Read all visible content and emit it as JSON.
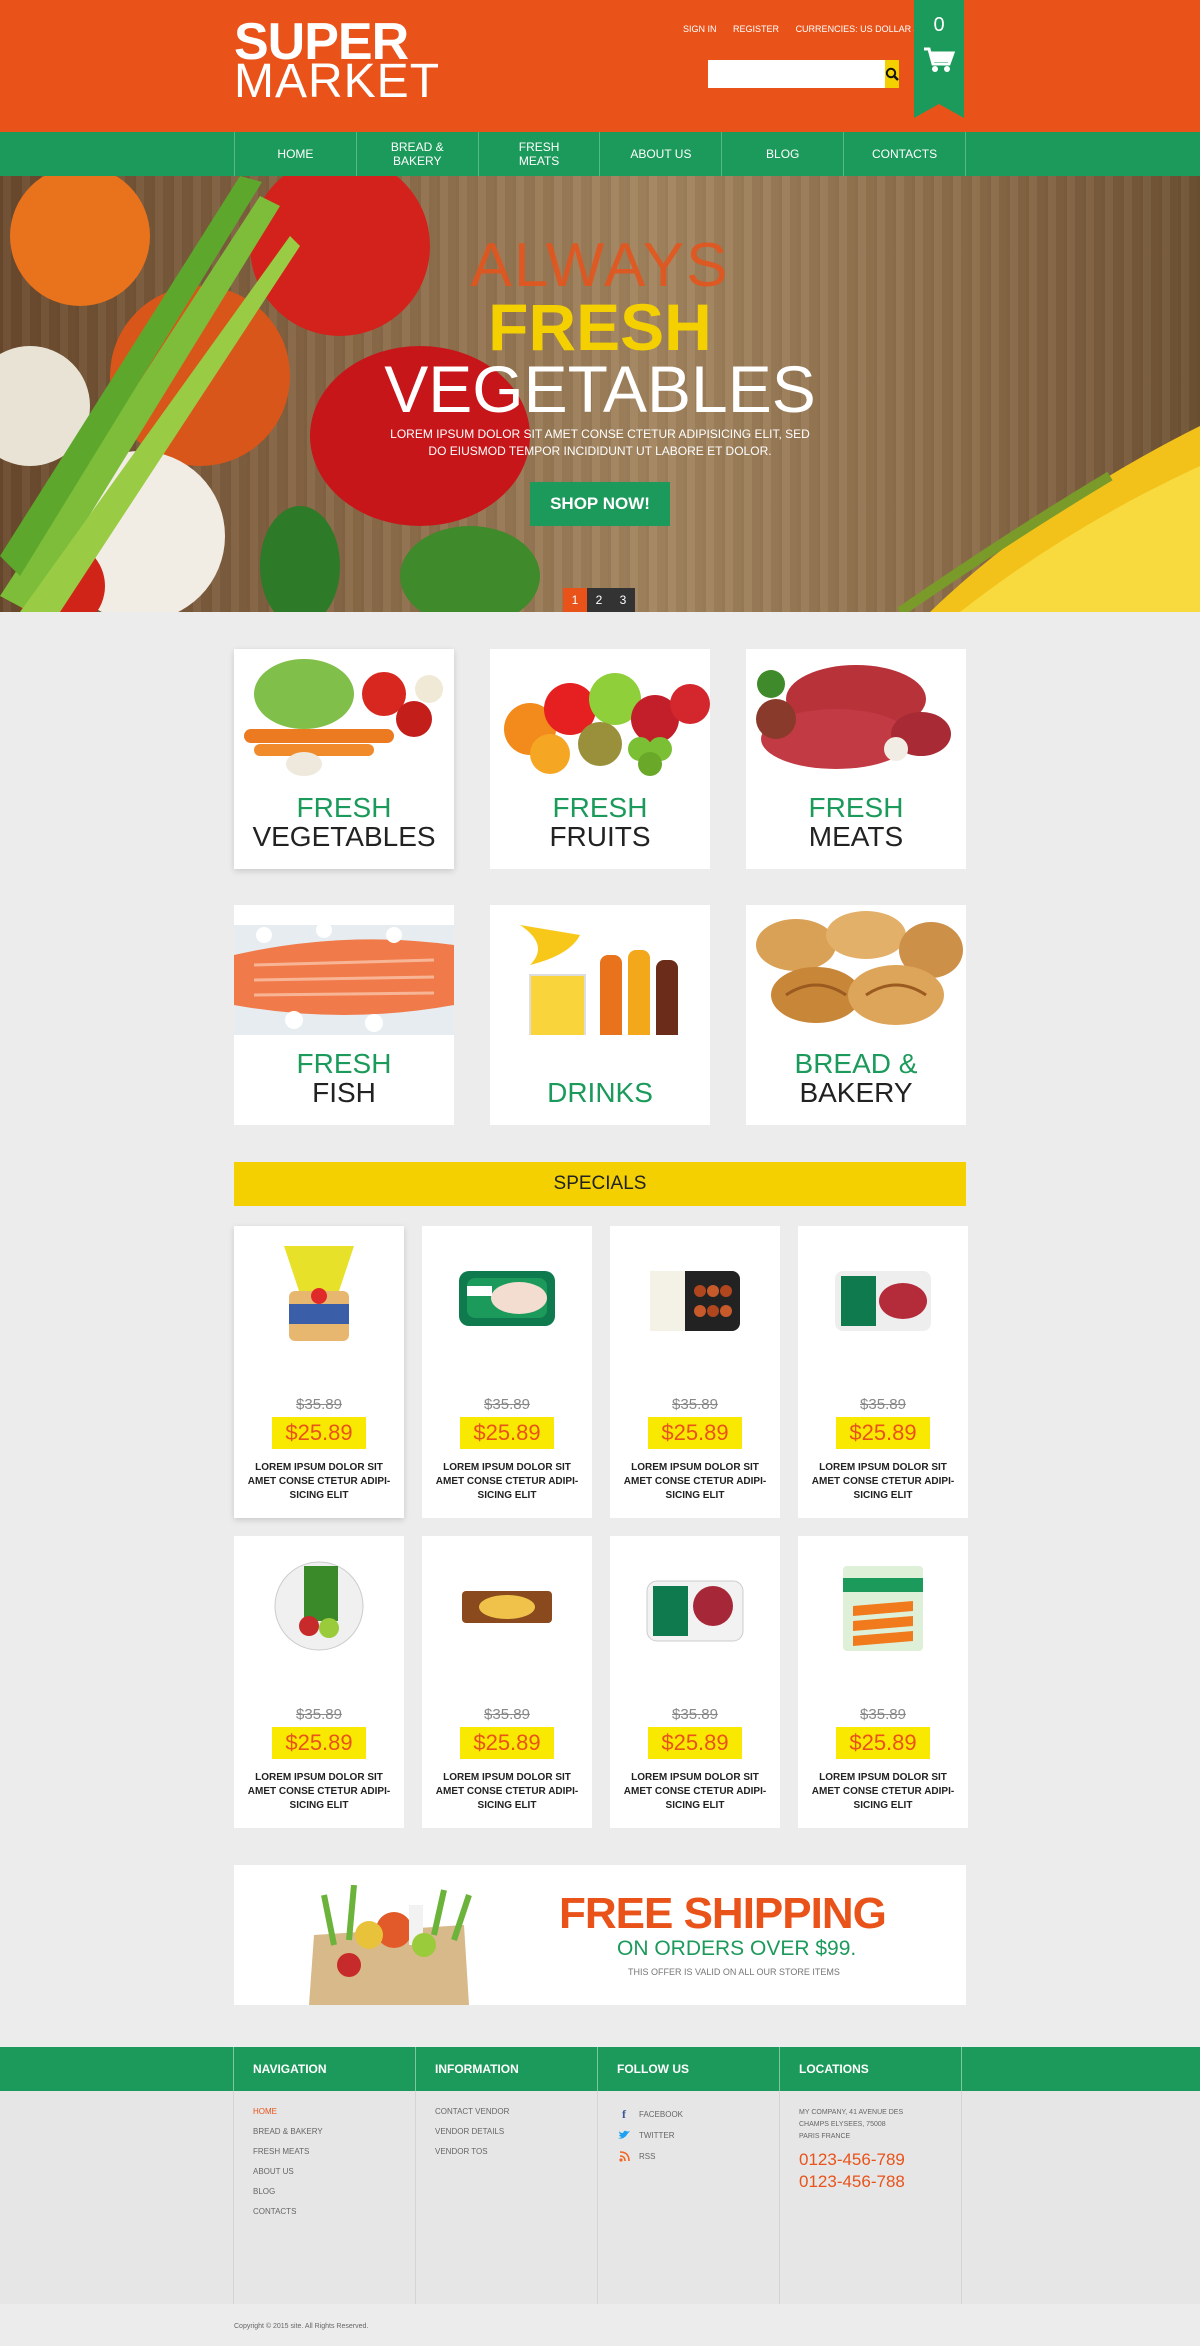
{
  "header": {
    "logo_line1": "SUPER",
    "logo_line2": "MARKET",
    "sign_in": "SIGN IN",
    "register": "REGISTER",
    "currencies": "CURRENCIES: US DOLLAR $",
    "search_placeholder": "",
    "cart_count": "0",
    "colors": {
      "header_bg": "#e9531a",
      "accent_green": "#1c9a5b",
      "accent_yellow": "#f4d000"
    }
  },
  "nav": {
    "items": [
      {
        "label": "HOME"
      },
      {
        "label": "BREAD & BAKERY"
      },
      {
        "label": "FRESH MEATS"
      },
      {
        "label": "ABOUT US"
      },
      {
        "label": "BLOG"
      },
      {
        "label": "CONTACTS"
      }
    ]
  },
  "hero": {
    "line1": "ALWAYS",
    "line2": "FRESH",
    "line3": "VEGETABLES",
    "subtitle": "LOREM IPSUM DOLOR SIT AMET CONSE CTETUR ADIPISICING ELIT, SED DO EIUSMOD TEMPOR INCIDIDUNT UT LABORE ET DOLOR.",
    "button": "SHOP NOW!",
    "pages": [
      "1",
      "2",
      "3"
    ]
  },
  "categories": [
    {
      "line1": "FRESH",
      "line2": "VEGETABLES"
    },
    {
      "line1": "FRESH",
      "line2": "FRUITS"
    },
    {
      "line1": "FRESH",
      "line2": "MEATS"
    },
    {
      "line1": "FRESH",
      "line2": "FISH"
    },
    {
      "line1": "DRINKS",
      "line2": ""
    },
    {
      "line1": "BREAD &",
      "line2": "BAKERY"
    }
  ],
  "specials": {
    "title": "SPECIALS",
    "products": [
      {
        "old": "$35.89",
        "price": "$25.89",
        "desc": "LOREM IPSUM DOLOR SIT AMET CONSE CTETUR ADIPI-SICING ELIT"
      },
      {
        "old": "$35.89",
        "price": "$25.89",
        "desc": "LOREM IPSUM DOLOR SIT AMET CONSE CTETUR ADIPI-SICING ELIT"
      },
      {
        "old": "$35.89",
        "price": "$25.89",
        "desc": "LOREM IPSUM DOLOR SIT AMET CONSE CTETUR ADIPI-SICING ELIT"
      },
      {
        "old": "$35.89",
        "price": "$25.89",
        "desc": "LOREM IPSUM DOLOR SIT AMET CONSE CTETUR ADIPI-SICING ELIT"
      },
      {
        "old": "$35.89",
        "price": "$25.89",
        "desc": "LOREM IPSUM DOLOR SIT AMET CONSE CTETUR ADIPI-SICING ELIT"
      },
      {
        "old": "$35.89",
        "price": "$25.89",
        "desc": "LOREM IPSUM DOLOR SIT AMET CONSE CTETUR ADIPI-SICING ELIT"
      },
      {
        "old": "$35.89",
        "price": "$25.89",
        "desc": "LOREM IPSUM DOLOR SIT AMET CONSE CTETUR ADIPI-SICING ELIT"
      },
      {
        "old": "$35.89",
        "price": "$25.89",
        "desc": "LOREM IPSUM DOLOR SIT AMET CONSE CTETUR ADIPI-SICING ELIT"
      }
    ]
  },
  "shipping": {
    "title": "FREE SHIPPING",
    "subtitle": "ON ORDERS OVER $99.",
    "note": "THIS OFFER IS VALID ON ALL OUR STORE ITEMS"
  },
  "footer": {
    "col_titles": [
      "NAVIGATION",
      "INFORMATION",
      "FOLLOW US",
      "LOCATIONS"
    ],
    "navigation": [
      "HOME",
      "BREAD & BAKERY",
      "FRESH MEATS",
      "ABOUT US",
      "BLOG",
      "CONTACTS"
    ],
    "information": [
      "CONTACT VENDOR",
      "VENDOR DETAILS",
      "VENDOR TOS"
    ],
    "follow": [
      "FACEBOOK",
      "TWITTER",
      "RSS"
    ],
    "address_line1": "MY COMPANY, 41 AVENUE DES",
    "address_line2": "CHAMPS ELYSEES, 75008",
    "address_line3": "PARIS FRANCE",
    "phone1": "0123-456-789",
    "phone2": "0123-456-788",
    "copyright": "Copyright © 2015 site. All Rights Reserved."
  }
}
